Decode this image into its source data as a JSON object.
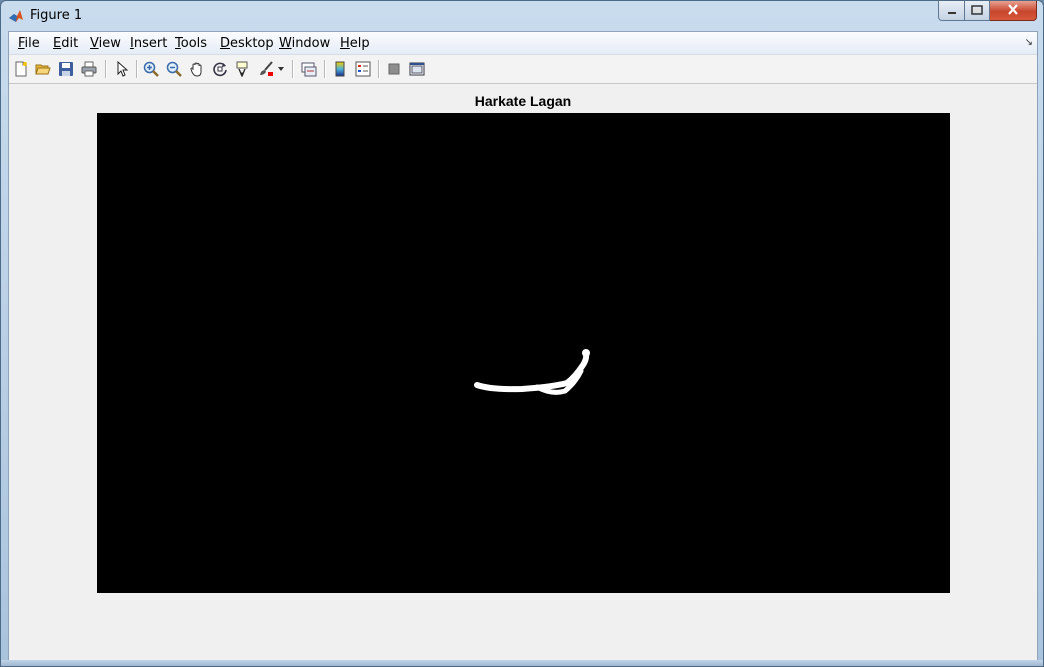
{
  "window": {
    "title": "Figure 1"
  },
  "menu": {
    "items": [
      {
        "label": "File",
        "accel": "F"
      },
      {
        "label": "Edit",
        "accel": "E"
      },
      {
        "label": "View",
        "accel": "V"
      },
      {
        "label": "Insert",
        "accel": "I"
      },
      {
        "label": "Tools",
        "accel": "T"
      },
      {
        "label": "Desktop",
        "accel": "D"
      },
      {
        "label": "Window",
        "accel": "W"
      },
      {
        "label": "Help",
        "accel": "H"
      }
    ]
  },
  "toolbar": {
    "icons": [
      "new-figure-icon",
      "open-file-icon",
      "save-icon",
      "print-icon",
      "edit-plot-icon",
      "zoom-in-icon",
      "zoom-out-icon",
      "pan-icon",
      "rotate-3d-icon",
      "data-cursor-icon",
      "brush-icon",
      "brush-dropdown-icon",
      "link-plot-icon",
      "insert-colorbar-icon",
      "insert-legend-icon",
      "hide-plot-tools-icon",
      "show-plot-tools-icon"
    ]
  },
  "figure": {
    "title": "Harkate Lagan",
    "background": "#000000",
    "stroke_color": "#ffffff"
  },
  "colors": {
    "close_button": "#c9462e",
    "menubar": "#e5ecf5"
  }
}
